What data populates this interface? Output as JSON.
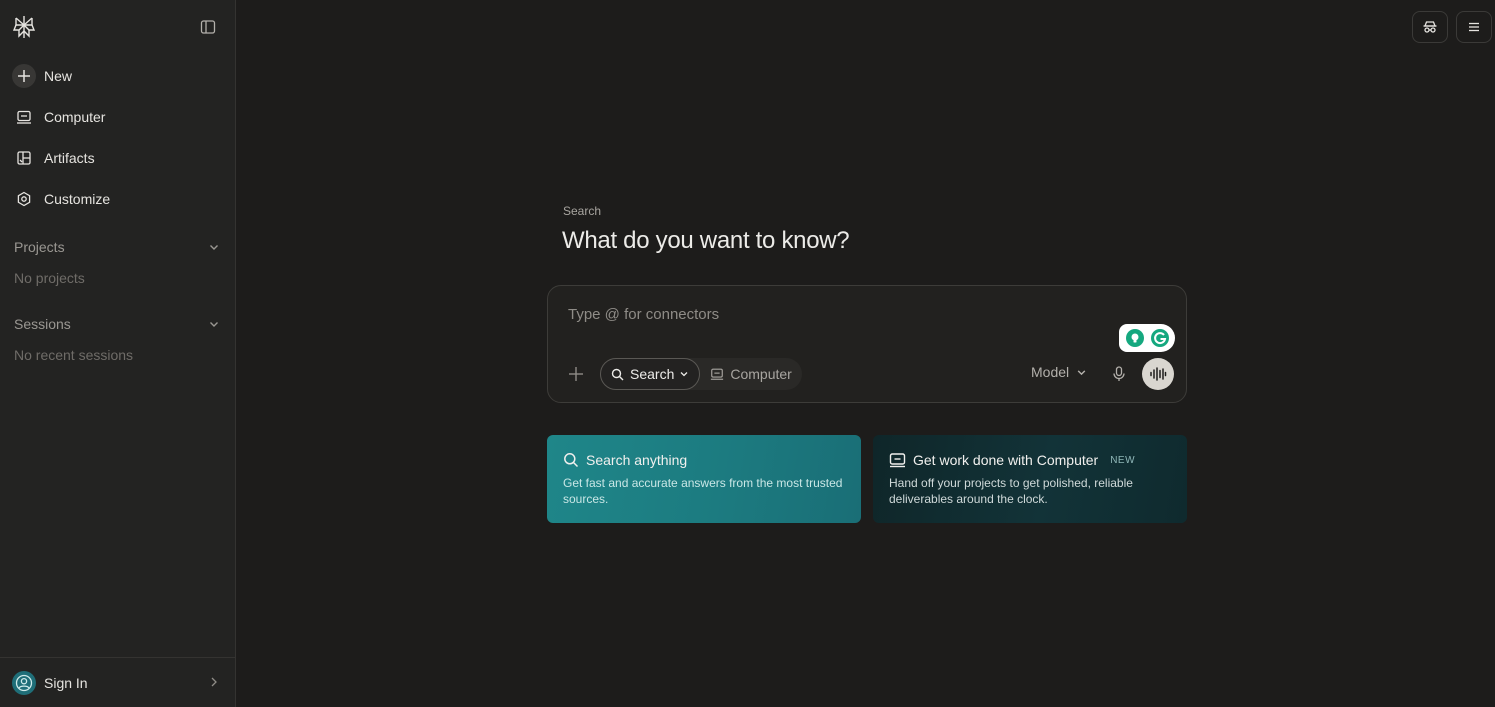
{
  "sidebar": {
    "nav": [
      {
        "label": "New",
        "icon": "plus-icon"
      },
      {
        "label": "Computer",
        "icon": "computer-icon"
      },
      {
        "label": "Artifacts",
        "icon": "artifacts-icon"
      },
      {
        "label": "Customize",
        "icon": "customize-icon"
      }
    ],
    "projects": {
      "label": "Projects",
      "empty": "No projects"
    },
    "sessions": {
      "label": "Sessions",
      "empty": "No recent sessions"
    },
    "sign_in": "Sign In"
  },
  "hero": {
    "label": "Search",
    "title": "What do you want to know?"
  },
  "composer": {
    "placeholder": "Type @ for connectors",
    "modes": [
      {
        "label": "Search",
        "active": true
      },
      {
        "label": "Computer",
        "active": false
      }
    ],
    "model_label": "Model"
  },
  "cards": [
    {
      "title": "Search anything",
      "description": "Get fast and accurate answers from the most trusted sources.",
      "icon": "search-icon"
    },
    {
      "title": "Get work done with Computer",
      "badge": "NEW",
      "description": "Hand off your projects to get polished, reliable deliverables around the clock.",
      "icon": "computer-icon"
    }
  ],
  "colors": {
    "background": "#1d1c1b",
    "sidebar": "#232322",
    "accent_teal": "#1f8689",
    "card_dark": "#123338"
  }
}
